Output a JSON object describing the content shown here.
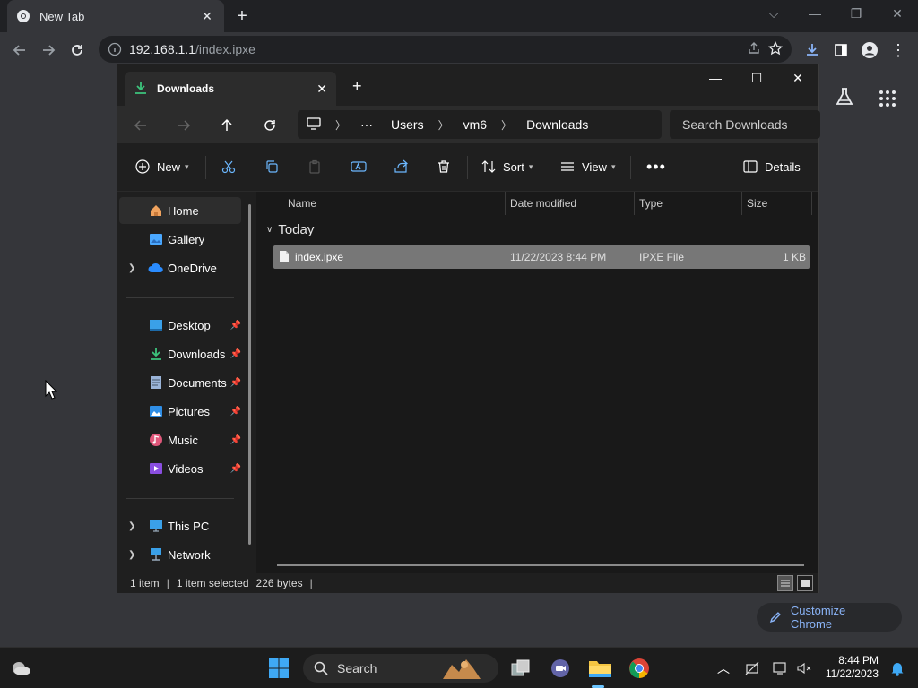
{
  "browser": {
    "tab_title": "New Tab",
    "url_host": "192.168.1.1",
    "url_path": "/index.ipxe",
    "customize_label": "Customize Chrome"
  },
  "explorer": {
    "tab_title": "Downloads",
    "breadcrumbs": [
      "Users",
      "vm6",
      "Downloads"
    ],
    "search_placeholder": "Search Downloads",
    "commands": {
      "new": "New",
      "sort": "Sort",
      "view": "View",
      "details": "Details"
    },
    "sidebar": {
      "top": [
        {
          "label": "Home"
        },
        {
          "label": "Gallery"
        },
        {
          "label": "OneDrive"
        }
      ],
      "pinned": [
        {
          "label": "Desktop"
        },
        {
          "label": "Downloads"
        },
        {
          "label": "Documents"
        },
        {
          "label": "Pictures"
        },
        {
          "label": "Music"
        },
        {
          "label": "Videos"
        }
      ],
      "bottom": [
        {
          "label": "This PC"
        },
        {
          "label": "Network"
        }
      ]
    },
    "columns": {
      "name": "Name",
      "date": "Date modified",
      "type": "Type",
      "size": "Size"
    },
    "group_label": "Today",
    "files": [
      {
        "name": "index.ipxe",
        "date": "11/22/2023 8:44 PM",
        "type": "IPXE File",
        "size": "1 KB"
      }
    ],
    "status": {
      "count": "1 item",
      "selection": "1 item selected",
      "bytes": "226 bytes"
    }
  },
  "taskbar": {
    "search_label": "Search",
    "time": "8:44 PM",
    "date": "11/22/2023"
  },
  "colors": {
    "accent": "#8ab4f8",
    "folder_yellow": "#f4c542",
    "download_green": "#3cc47c"
  }
}
